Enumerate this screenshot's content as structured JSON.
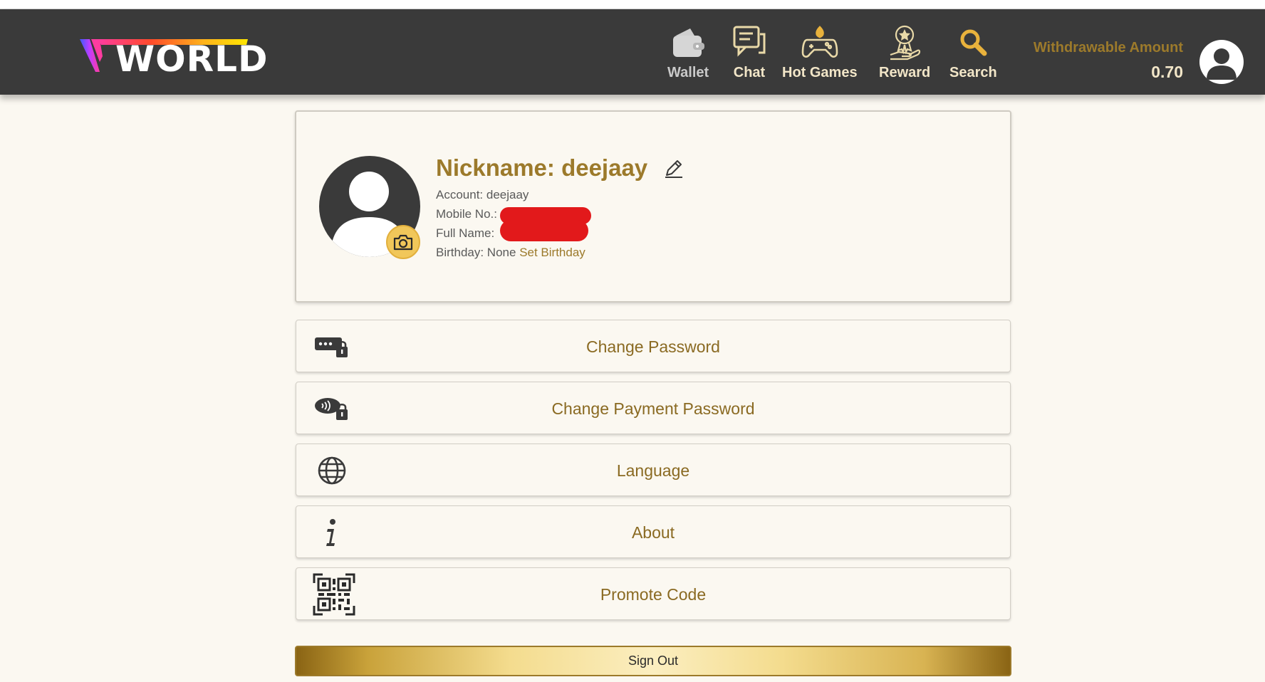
{
  "header": {
    "logo_text": "WORLD",
    "logo_mark": "V",
    "nav": [
      {
        "label": "Wallet",
        "icon": "wallet-icon"
      },
      {
        "label": "Chat",
        "icon": "chat-icon"
      },
      {
        "label": "Hot Games",
        "icon": "gamepad-icon"
      },
      {
        "label": "Reward",
        "icon": "reward-icon"
      },
      {
        "label": "Search",
        "icon": "search-icon"
      }
    ],
    "withdrawable_label": "Withdrawable Amount",
    "withdrawable_value": "0.70"
  },
  "profile": {
    "nickname": "Nickname: deejaay",
    "account": "Account: deejaay",
    "mobile_label": "Mobile No.:",
    "fullname_label": "Full Name:",
    "birthday_label": "Birthday: None",
    "set_birthday": "Set Birthday"
  },
  "menu": [
    {
      "label": "Change Password",
      "icon": "password-lock-icon"
    },
    {
      "label": "Change Payment Password",
      "icon": "payment-lock-icon"
    },
    {
      "label": "Language",
      "icon": "globe-icon"
    },
    {
      "label": "About",
      "icon": "info-icon"
    },
    {
      "label": "Promote Code",
      "icon": "qr-code-icon"
    }
  ],
  "signout_label": "Sign Out",
  "colors": {
    "header_bg": "#3a3a3a",
    "accent_gold": "#9c7a2b",
    "page_bg": "#fbf8f1",
    "redaction": "#e2191b"
  }
}
